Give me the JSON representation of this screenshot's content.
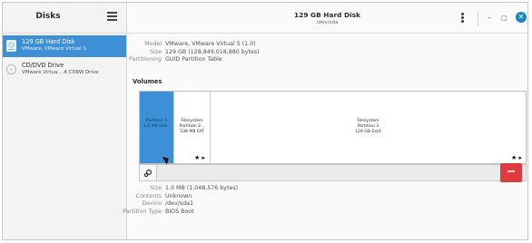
{
  "sidebar": {
    "title": "Disks",
    "devices": [
      {
        "name": "129 GB Hard Disk",
        "desc": "VMware, VMware Virtual S",
        "icon": "hard-disk-icon"
      },
      {
        "name": "CD/DVD Drive",
        "desc": "VMware Virtua... A CDRW Drive",
        "icon": "optical-drive-icon"
      }
    ]
  },
  "header": {
    "title": "129 GB Hard Disk",
    "subtitle": "/dev/sda",
    "window_buttons": {
      "minimize": "–",
      "maximize": "□",
      "close": "✕"
    }
  },
  "disk_info": [
    {
      "label": "Model",
      "value": "VMware, VMware Virtual S (1.0)"
    },
    {
      "label": "Size",
      "value": "129 GB (128,849,018,880 bytes)"
    },
    {
      "label": "Partitioning",
      "value": "GUID Partition Table"
    }
  ],
  "volumes": {
    "heading": "Volumes",
    "partitions": [
      {
        "line1": "Partition 1",
        "line2": "1.0 MB Unk..",
        "line3": "",
        "selected": true
      },
      {
        "line1": "Filesystem",
        "line2": "Partition 2...",
        "line3": "538 MB FAT",
        "selected": false,
        "marks": "★ ▸"
      },
      {
        "line1": "Filesystem",
        "line2": "Partition 3",
        "line3": "128 GB Ext4",
        "selected": false,
        "marks": "★ ▸"
      }
    ],
    "toolbar": {
      "settings_icon": "gears-icon",
      "delete_label": "−"
    }
  },
  "selected_partition": [
    {
      "label": "Size",
      "value": "1.0 MB (1,048,576 bytes)"
    },
    {
      "label": "Contents",
      "value": "Unknown"
    },
    {
      "label": "Device",
      "value": "/dev/sda1"
    },
    {
      "label": "Partition Type",
      "value": "BIOS Boot"
    }
  ],
  "colors": {
    "accent": "#3d8fd6",
    "delete": "#e0393e",
    "close": "#1a86c8"
  }
}
